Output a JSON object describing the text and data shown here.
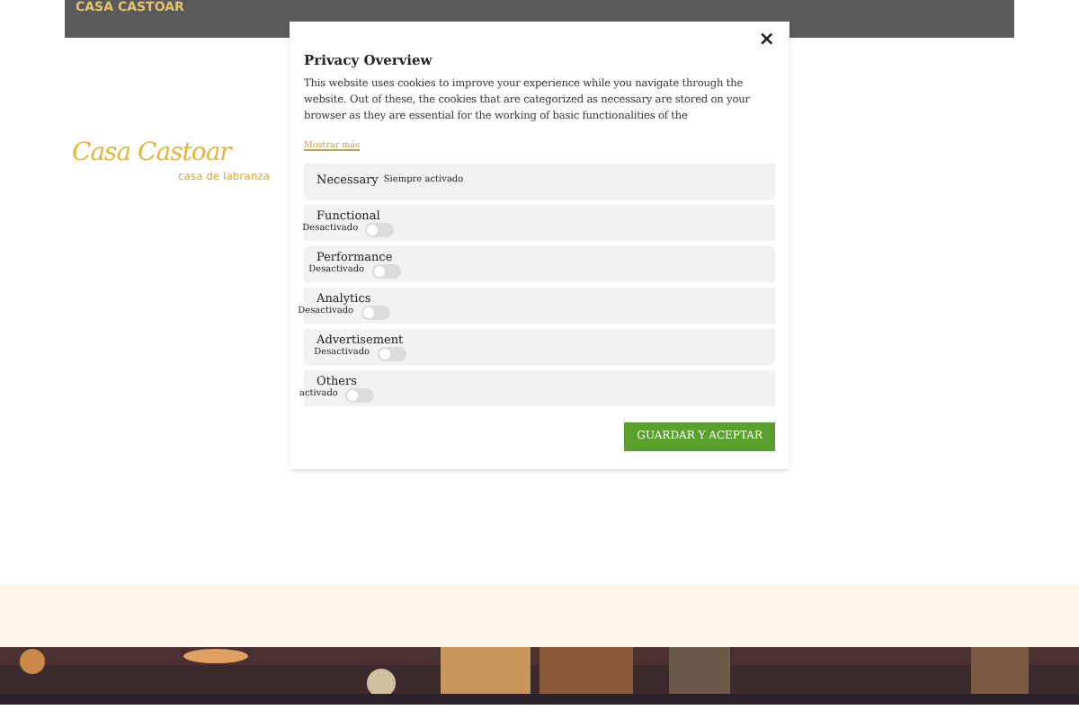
{
  "top_bar": {
    "site_name": "CASA CASTOAR"
  },
  "logo": {
    "name": "Casa Castoar",
    "tagline": "casa de labranza"
  },
  "modal": {
    "title": "Privacy Overview",
    "description": "This website uses cookies to improve your experience while you navigate through the website. Out of these, the cookies that are categorized as necessary are stored on your browser as they are essential for the working of basic functionalities of the",
    "show_more": "Mostrar más",
    "categories": [
      {
        "kind": "always",
        "name": "Necessary",
        "status": "Siempre activado"
      },
      {
        "kind": "toggle",
        "name": "Functional",
        "status": "Desactivado",
        "on": false
      },
      {
        "kind": "toggle",
        "name": "Performance",
        "status": "Desactivado",
        "on": false
      },
      {
        "kind": "toggle",
        "name": "Analytics",
        "status": "Desactivado",
        "on": false
      },
      {
        "kind": "toggle",
        "name": "Advertisement",
        "status": "Desactivado",
        "on": false
      },
      {
        "kind": "toggle",
        "name": "Others",
        "status": "activado",
        "on": false
      }
    ],
    "close": "×",
    "save_button": "GUARDAR Y ACEPTAR"
  }
}
